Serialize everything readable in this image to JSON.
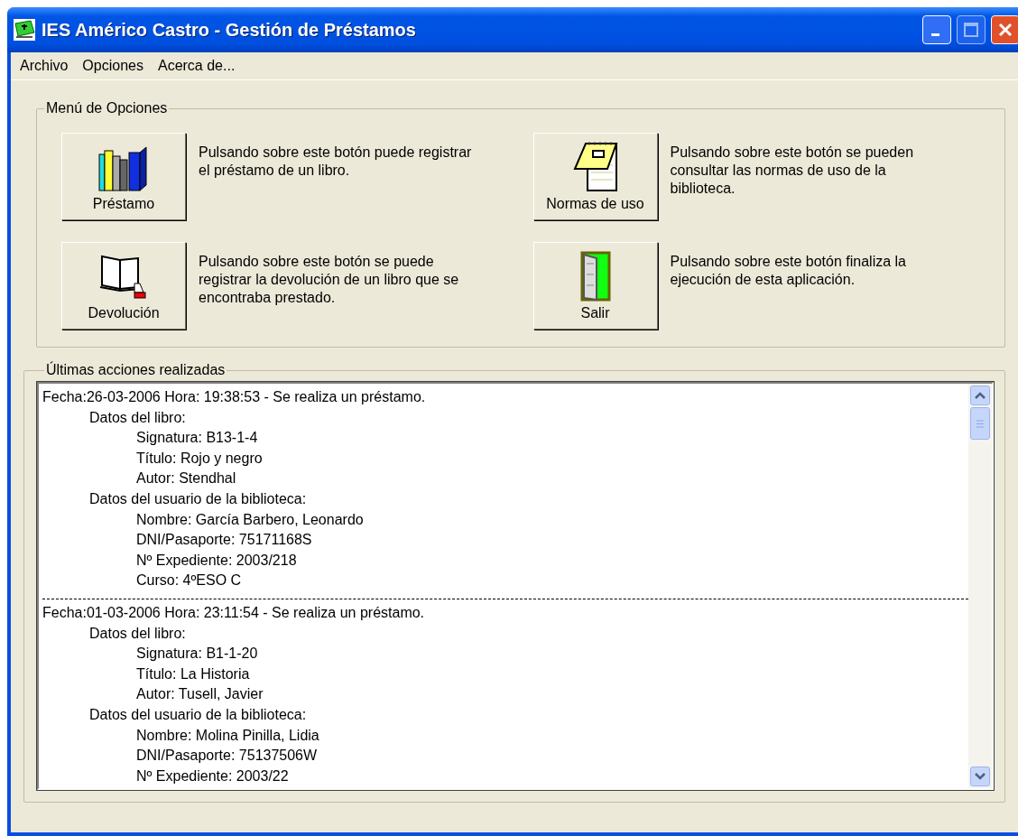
{
  "window": {
    "title": "IES Américo Castro - Gestión de Préstamos"
  },
  "menu": [
    "Archivo",
    "Opciones",
    "Acerca de..."
  ],
  "options_group": {
    "title": "Menú de Opciones",
    "options": [
      {
        "kind": "loan",
        "label": "Préstamo",
        "description": "Pulsando sobre este botón puede registrar el préstamo de un libro."
      },
      {
        "kind": "rules",
        "label": "Normas de uso",
        "description": "Pulsando sobre este botón se pueden consultar las normas de uso de la biblioteca."
      },
      {
        "kind": "return",
        "label": "Devolución",
        "description": "Pulsando sobre este botón se puede registrar la devolución de un libro que se encontraba prestado."
      },
      {
        "kind": "exit",
        "label": "Salir",
        "description": "Pulsando sobre este botón finaliza la ejecución de esta aplicación."
      }
    ]
  },
  "log_group": {
    "title": "Últimas acciones realizadas",
    "entries": [
      {
        "text": "Fecha:26-03-2006 Hora: 19:38:53 - Se realiza un préstamo.",
        "children": [
          {
            "text": "Datos del libro:",
            "children": [
              {
                "text": "Signatura: B13-1-4"
              },
              {
                "text": "Título: Rojo y negro"
              },
              {
                "text": "Autor: Stendhal"
              }
            ]
          },
          {
            "text": "Datos del usuario de la biblioteca:",
            "children": [
              {
                "text": "Nombre: García Barbero, Leonardo"
              },
              {
                "text": "DNI/Pasaporte: 75171168S"
              },
              {
                "text": "Nº Expediente: 2003/218"
              },
              {
                "text": "Curso: 4ºESO C"
              }
            ]
          }
        ]
      },
      {
        "text": "Fecha:01-03-2006 Hora: 23:11:54 - Se realiza un préstamo.",
        "children": [
          {
            "text": "Datos del libro:",
            "children": [
              {
                "text": "Signatura: B1-1-20"
              },
              {
                "text": "Título: La Historia"
              },
              {
                "text": "Autor: Tusell, Javier"
              }
            ]
          },
          {
            "text": "Datos del usuario de la biblioteca:",
            "children": [
              {
                "text": "Nombre: Molina Pinilla, Lidia"
              },
              {
                "text": "DNI/Pasaporte: 75137506W"
              },
              {
                "text": "Nº Expediente: 2003/22"
              }
            ]
          }
        ]
      }
    ]
  }
}
